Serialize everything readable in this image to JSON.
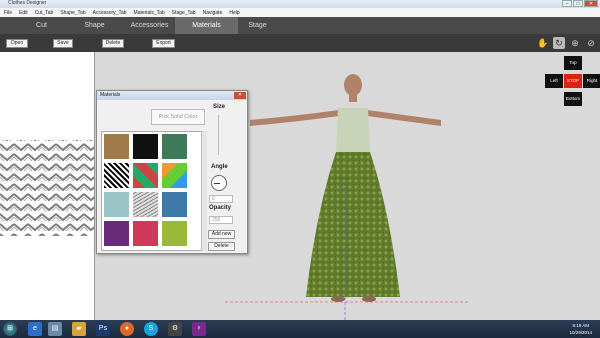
{
  "window": {
    "title": "Clothes Designer"
  },
  "menu": [
    "File",
    "Edit",
    "Cut_Tab",
    "Shape_Tab",
    "Accessory_Tab",
    "Materials_Tab",
    "Stage_Tab",
    "Navigate",
    "Help"
  ],
  "tabs": [
    "Cut",
    "Shape",
    "Accessories",
    "Materials",
    "Stage"
  ],
  "active_tab": "Materials",
  "toolbar": {
    "open": "Open",
    "save": "Save",
    "delete": "Delete",
    "export": "Export"
  },
  "nav": {
    "top": "Top",
    "left": "Left",
    "stop": "STOP",
    "right": "Right",
    "bottom": "Bottom"
  },
  "dialog": {
    "title": "Materials",
    "pick_solid_color": "Pick Solid Color",
    "size_label": "Size",
    "angle_label": "Angle",
    "angle_value": "0",
    "opacity_label": "Opacity",
    "opacity_value": "255",
    "add_new": "Add new",
    "delete": "Delete"
  },
  "clock": {
    "time": "9:19 AM",
    "date": "10/29/2014"
  },
  "colors": {
    "tabbar": "#4a4a4a",
    "toolbar": "#3a3a3a",
    "stop": "#dd2211",
    "dress": "#5e7a2a"
  }
}
